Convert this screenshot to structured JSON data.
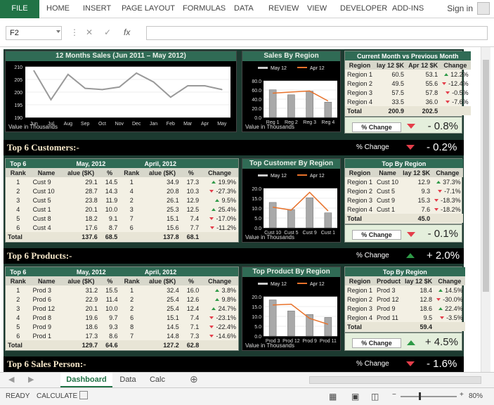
{
  "ribbon": {
    "file": "FILE",
    "tabs": [
      "HOME",
      "INSERT",
      "PAGE LAYOUT",
      "FORMULAS",
      "DATA",
      "REVIEW",
      "VIEW",
      "DEVELOPER",
      "ADD-INS"
    ],
    "sign_in": "Sign in"
  },
  "formula_bar": {
    "name_box": "F2",
    "fx": "fx",
    "content": ""
  },
  "sales12": {
    "title": "12 Months Sales (Jun 2011 – May 2012)",
    "note": "Value in Thousands",
    "y_ticks": [
      "210",
      "205",
      "200",
      "195",
      "190"
    ],
    "chart_data": {
      "type": "line",
      "x": [
        "Jun",
        "Jul",
        "Aug",
        "Sep",
        "Oct",
        "Nov",
        "Dec",
        "Jan",
        "Feb",
        "Mar",
        "Apr",
        "May"
      ],
      "values": [
        208.5,
        197,
        207,
        201.5,
        201,
        202,
        207.5,
        204,
        198,
        202.5,
        202.5,
        201
      ],
      "ylim": [
        190,
        210
      ]
    }
  },
  "sales_region": {
    "title": "Sales By Region",
    "note": "Value in Thousands",
    "legend": [
      "May 12",
      "Apr 12"
    ],
    "y_ticks": [
      "80.0",
      "60.0",
      "40.0",
      "20.0",
      "0.0"
    ],
    "chart_data": {
      "type": "bar",
      "categories": [
        "Reg 1",
        "Reg 2",
        "Reg 3",
        "Reg 4"
      ],
      "series": [
        {
          "name": "May 12",
          "values": [
            60.5,
            49.5,
            57.5,
            33.5
          ]
        },
        {
          "name": "Apr 12",
          "values": [
            53.1,
            55.6,
            57.8,
            36.0
          ]
        }
      ],
      "ylim": [
        0,
        80
      ]
    }
  },
  "cm_vs_pm": {
    "title": "Current Month vs Previous Month",
    "headers": [
      "Region",
      "lay 12 $K",
      "Apr 12 $K",
      "Change"
    ],
    "rows": [
      [
        "Region 1",
        "60.5",
        "53.1",
        "12.2%",
        "up"
      ],
      [
        "Region 2",
        "49.5",
        "55.6",
        "-12.4%",
        "down"
      ],
      [
        "Region 3",
        "57.5",
        "57.8",
        "-0.5%",
        "down"
      ],
      [
        "Region 4",
        "33.5",
        "36.0",
        "-7.6%",
        "down"
      ]
    ],
    "total": [
      "Total",
      "200.9",
      "202.5"
    ],
    "change_label": "% Change",
    "change_value": "- 0.8%",
    "change_dir": "down"
  },
  "sections": [
    {
      "title": "Top 6 Customers:-",
      "chg": "% Change",
      "pct": "- 0.2%",
      "dir": "down"
    },
    {
      "title": "Top 6 Products:-",
      "chg": "% Change",
      "pct": "+ 2.0%",
      "dir": "up"
    },
    {
      "title": "Top 6 Sales Person:-",
      "chg": "% Change",
      "pct": "- 1.6%",
      "dir": "down"
    }
  ],
  "customers": {
    "top_label": "Top 6",
    "month1": "May, 2012",
    "month2": "April, 2012",
    "sub": [
      "Rank",
      "Name",
      "alue ($K)",
      "%",
      "Rank",
      "alue ($K)",
      "%",
      "Change"
    ],
    "rows": [
      [
        "1",
        "Cust 9",
        "29.1",
        "14.5",
        "1",
        "34.9",
        "17.3",
        "19.9%",
        "up"
      ],
      [
        "2",
        "Cust 10",
        "28.7",
        "14.3",
        "4",
        "20.8",
        "10.3",
        "-27.3%",
        "down"
      ],
      [
        "3",
        "Cust 5",
        "23.8",
        "11.9",
        "2",
        "26.1",
        "12.9",
        "9.5%",
        "up"
      ],
      [
        "4",
        "Cust 1",
        "20.1",
        "10.0",
        "3",
        "25.3",
        "12.5",
        "25.4%",
        "up"
      ],
      [
        "5",
        "Cust 8",
        "18.2",
        "9.1",
        "7",
        "15.1",
        "7.4",
        "-17.0%",
        "down"
      ],
      [
        "6",
        "Cust 4",
        "17.6",
        "8.7",
        "6",
        "15.6",
        "7.7",
        "-11.2%",
        "down"
      ]
    ],
    "total": [
      "Total",
      "137.6",
      "68.5",
      "137.8",
      "68.1"
    ],
    "chart": {
      "title": "Top Customer By Region",
      "legend": [
        "May 12",
        "Apr 12"
      ],
      "y_ticks": [
        "20.0",
        "15.0",
        "10.0",
        "5.0",
        "0.0"
      ],
      "note": "Value in Thousands",
      "chart_data": {
        "type": "bar",
        "categories": [
          "Cust 10",
          "Cust 5",
          "Cust 9",
          "Cust 1"
        ],
        "series": [
          {
            "name": "May 12",
            "values": [
              12.9,
              9.3,
              15.3,
              7.6
            ]
          },
          {
            "name": "Apr 12",
            "values": [
              10.5,
              9.0,
              18.0,
              8.6
            ]
          }
        ],
        "ylim": [
          0,
          20
        ]
      }
    },
    "region": {
      "title": "Top By Region",
      "headers": [
        "Region",
        "Name",
        "lay 12 $K",
        "Change"
      ],
      "rows": [
        [
          "Region 1",
          "Cust 10",
          "12.9",
          "37.3%",
          "up"
        ],
        [
          "Region 2",
          "Cust 5",
          "9.3",
          "-7.1%",
          "down"
        ],
        [
          "Region 3",
          "Cust 9",
          "15.3",
          "-18.3%",
          "down"
        ],
        [
          "Region 4",
          "Cust 1",
          "7.6",
          "-18.2%",
          "down"
        ]
      ],
      "total": [
        "Total",
        "45.0"
      ],
      "change_label": "% Change",
      "change_value": "- 0.1%",
      "change_dir": "down"
    }
  },
  "products": {
    "top_label": "Top 6",
    "month1": "May, 2012",
    "month2": "April, 2012",
    "sub": [
      "Rank",
      "Name",
      "alue ($K)",
      "%",
      "Rank",
      "alue ($K)",
      "%",
      "Change"
    ],
    "rows": [
      [
        "1",
        "Prod 3",
        "31.2",
        "15.5",
        "1",
        "32.4",
        "16.0",
        "3.8%",
        "up"
      ],
      [
        "2",
        "Prod 6",
        "22.9",
        "11.4",
        "2",
        "25.4",
        "12.6",
        "9.8%",
        "up"
      ],
      [
        "3",
        "Prod 12",
        "20.1",
        "10.0",
        "2",
        "25.4",
        "12.4",
        "24.7%",
        "up"
      ],
      [
        "4",
        "Prod 8",
        "19.6",
        "9.7",
        "6",
        "15.1",
        "7.4",
        "-23.1%",
        "down"
      ],
      [
        "5",
        "Prod 9",
        "18.6",
        "9.3",
        "8",
        "14.5",
        "7.1",
        "-22.4%",
        "down"
      ],
      [
        "6",
        "Prod 1",
        "17.3",
        "8.6",
        "7",
        "14.8",
        "7.3",
        "-14.6%",
        "down"
      ]
    ],
    "total": [
      "Total",
      "129.7",
      "64.6",
      "127.2",
      "62.8"
    ],
    "chart": {
      "title": "Top Product By Region",
      "legend": [
        "May 12",
        "Apr 12"
      ],
      "y_ticks": [
        "20.0",
        "15.0",
        "10.0",
        "5.0",
        "0.0"
      ],
      "note": "Value in Thousands",
      "chart_data": {
        "type": "bar",
        "categories": [
          "Prod 3",
          "Prod 12",
          "Prod 9",
          "Prod 11"
        ],
        "series": [
          {
            "name": "May 12",
            "values": [
              18.4,
              12.8,
              11.0,
              9.5
            ]
          },
          {
            "name": "Apr 12",
            "values": [
              15.8,
              16.2,
              9.0,
              6.0
            ]
          }
        ],
        "ylim": [
          0,
          20
        ]
      }
    },
    "region": {
      "title": "Top By Region",
      "headers": [
        "Region",
        "Product",
        "lay 12 $K",
        "Change"
      ],
      "rows": [
        [
          "Region 1",
          "Prod 3",
          "18.4",
          "14.5%",
          "up"
        ],
        [
          "Region 2",
          "Prod 12",
          "12.8",
          "-30.0%",
          "down"
        ],
        [
          "Region 3",
          "Prod 9",
          "18.6",
          "22.4%",
          "up"
        ],
        [
          "Region 4",
          "Prod 11",
          "9.5",
          "-3.5%",
          "down"
        ]
      ],
      "total": [
        "Total",
        "59.4"
      ],
      "change_label": "% Change",
      "change_value": "+ 4.5%",
      "change_dir": "up"
    }
  },
  "sheet_tabs": [
    "Dashboard",
    "Data",
    "Calc"
  ],
  "status": {
    "ready": "READY",
    "calculate": "CALCULATE",
    "zoom": "80%"
  }
}
